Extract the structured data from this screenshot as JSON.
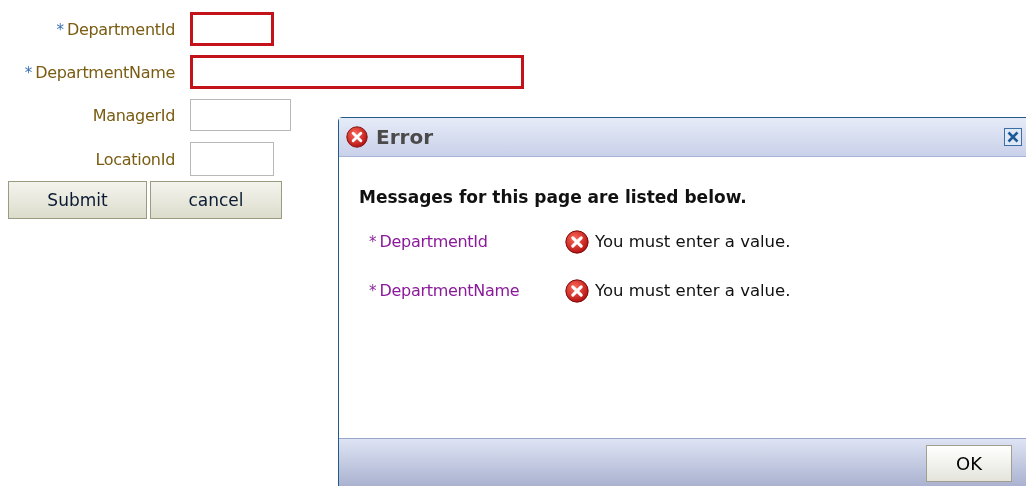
{
  "form": {
    "fields": [
      {
        "required_mark": "*",
        "label": "DepartmentId",
        "invalid": true
      },
      {
        "required_mark": "*",
        "label": "DepartmentName",
        "invalid": true
      },
      {
        "label": "ManagerId",
        "invalid": false
      },
      {
        "label": "LocationId",
        "invalid": false
      }
    ],
    "buttons": [
      "Submit",
      "cancel"
    ]
  },
  "dialog": {
    "title": "Error",
    "heading": "Messages for this page are listed below.",
    "messages": [
      {
        "required_mark": "*",
        "field": "DepartmentId",
        "text": "You must enter a value."
      },
      {
        "required_mark": "*",
        "field": "DepartmentName",
        "text": "You must enter a value."
      }
    ],
    "buttons": [
      "OK"
    ]
  }
}
